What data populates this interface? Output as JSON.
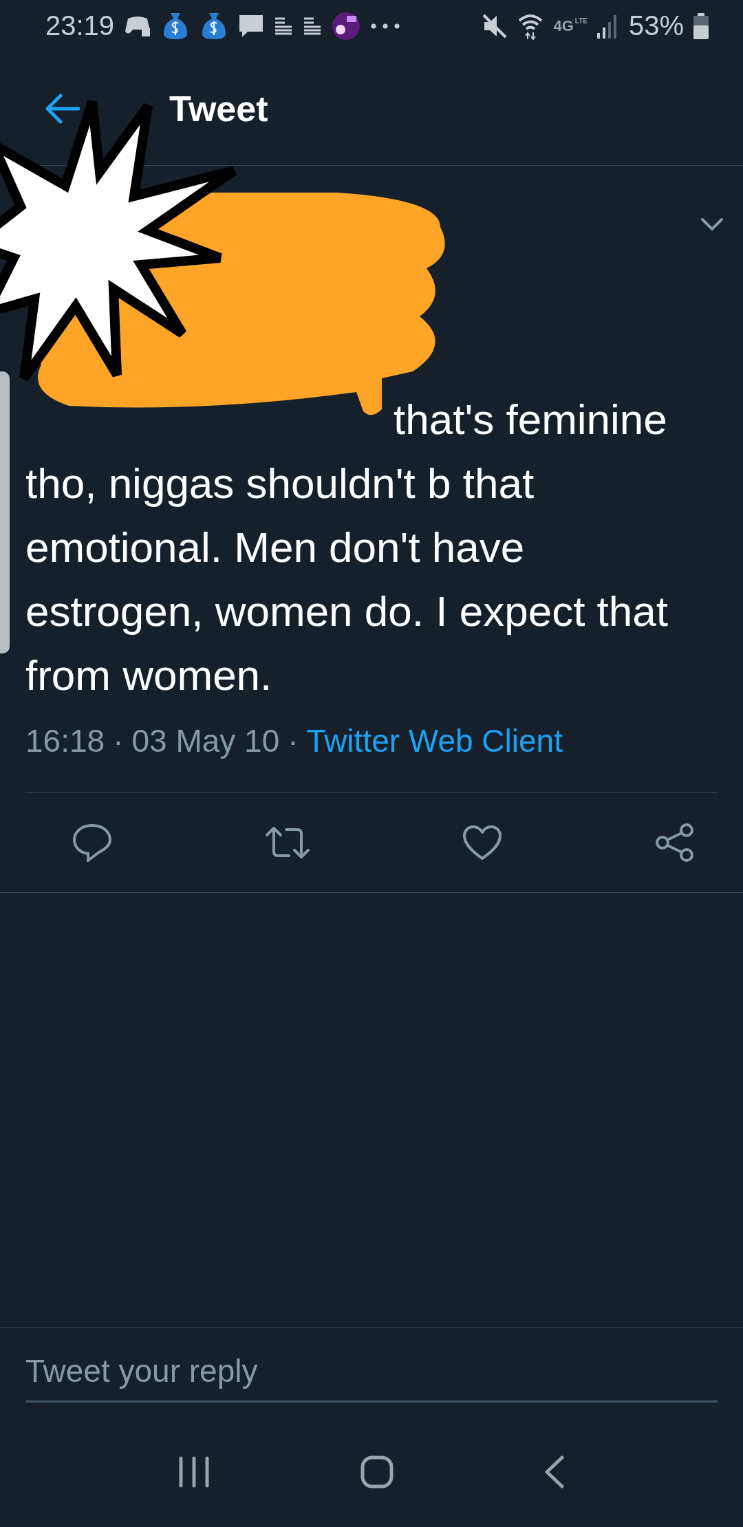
{
  "status_bar": {
    "time": "23:19",
    "network": "4G",
    "network_sub": "LTE",
    "battery": "53%"
  },
  "header": {
    "title": "Tweet"
  },
  "tweet": {
    "text": "that's feminine tho, niggas shouldn't b that emotional. Men don't have estrogen, women do. I expect that from women.",
    "meta": [
      {
        "text": "16:18",
        "kind": "plain"
      },
      {
        "text": "·",
        "kind": "plain"
      },
      {
        "text": "03 May 10",
        "kind": "plain"
      },
      {
        "text": "·",
        "kind": "plain"
      },
      {
        "text": "Twitter Web Client",
        "kind": "link"
      }
    ],
    "actions": [
      {
        "kind": "reply"
      },
      {
        "kind": "retweet"
      },
      {
        "kind": "like"
      },
      {
        "kind": "share"
      }
    ]
  },
  "reply": {
    "placeholder": "Tweet your reply"
  },
  "nav_bar": [
    {
      "kind": "recents"
    },
    {
      "kind": "home"
    },
    {
      "kind": "back"
    }
  ]
}
